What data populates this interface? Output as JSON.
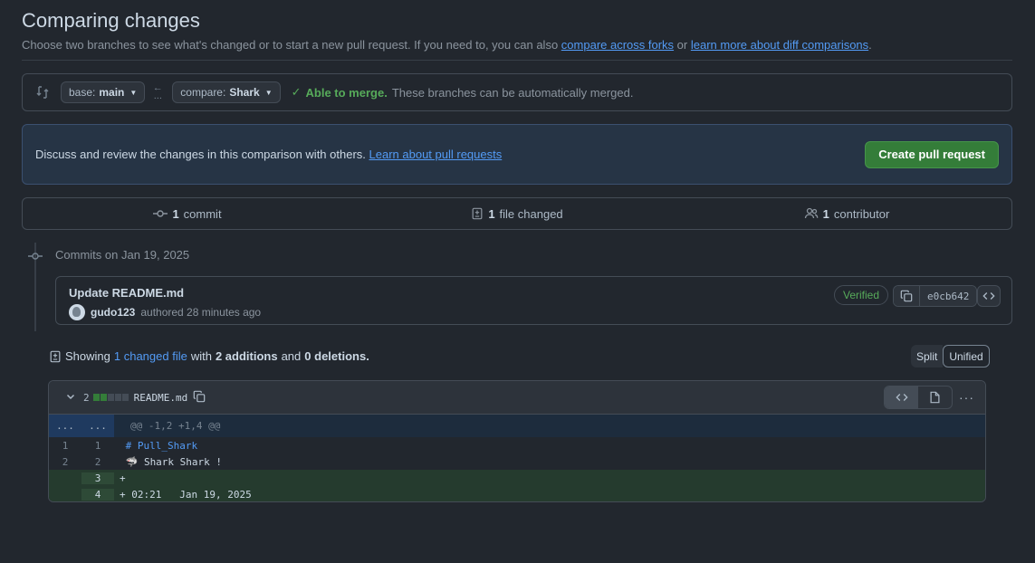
{
  "page": {
    "title": "Comparing changes",
    "subtitle_prefix": "Choose two branches to see what's changed or to start a new pull request. If you need to, you can also ",
    "subtitle_link1": "compare across forks",
    "subtitle_or": " or ",
    "subtitle_link2": "learn more about diff comparisons",
    "subtitle_end": "."
  },
  "range": {
    "base_prefix": "base:",
    "base_branch": "main",
    "compare_prefix": "compare:",
    "compare_branch": "Shark",
    "arrow": "←",
    "dots": "...",
    "merge_strong": "Able to merge.",
    "merge_rest": "These branches can be automatically merged."
  },
  "discuss": {
    "text": "Discuss and review the changes in this comparison with others. ",
    "link": "Learn about pull requests",
    "button": "Create pull request"
  },
  "stats": {
    "commits_count": "1",
    "commits_label": "commit",
    "files_count": "1",
    "files_label": "file changed",
    "contributors_count": "1",
    "contributors_label": "contributor"
  },
  "commits": {
    "date_heading": "Commits on Jan 19, 2025",
    "items": [
      {
        "title": "Update README.md",
        "author": "gudo123",
        "meta": "authored 28 minutes ago",
        "verified": "Verified",
        "sha": "e0cb642"
      }
    ]
  },
  "summary": {
    "prefix": "Showing",
    "changed": "1 changed file",
    "with": "with",
    "additions": "2 additions",
    "and": "and",
    "deletions": "0 deletions."
  },
  "view_toggle": {
    "split": "Split",
    "unified": "Unified"
  },
  "file": {
    "changes_count": "2",
    "diffstat": [
      1,
      1,
      0,
      0,
      0
    ],
    "name": "README.md",
    "hunk_left": "...",
    "hunk_right": "...",
    "hunk_header": "@@ -1,2 +1,4 @@",
    "lines": [
      {
        "type": "ctx",
        "old": "1",
        "new": "1",
        "text": " # Pull_Shark"
      },
      {
        "type": "ctx",
        "old": "2",
        "new": "2",
        "text": " 🦈 Shark Shark !"
      },
      {
        "type": "add",
        "old": "",
        "new": "3",
        "text": "+"
      },
      {
        "type": "add",
        "old": "",
        "new": "4",
        "text": "+ 02:21   Jan 19, 2025"
      }
    ]
  },
  "colors": {
    "background": "#22272e",
    "accent_link": "#539bf5",
    "success": "#57ab5a",
    "primary_button": "#347d39"
  }
}
